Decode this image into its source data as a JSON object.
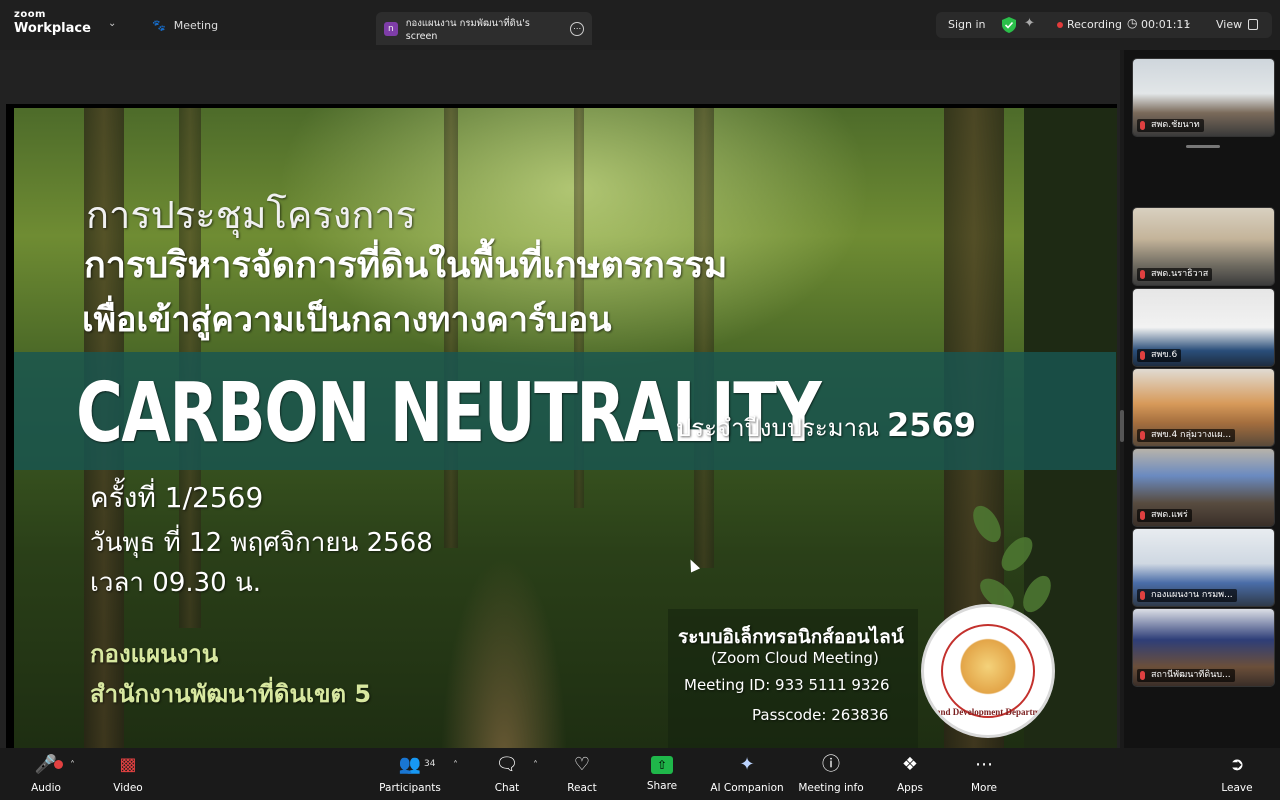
{
  "app": {
    "brand_top": "zoom",
    "brand_bottom": "Workplace",
    "meeting_tab": "Meeting",
    "shared_screen_tab": "กองแผนงาน กรมพัฒนาที่ดิน's screen",
    "shared_avatar": "n"
  },
  "status": {
    "sign_in": "Sign in",
    "recording": "Recording",
    "elapsed": "00:01:11",
    "view": "View"
  },
  "slide": {
    "line1": "การประชุมโครงการ",
    "line2": "การบริหารจัดการที่ดินในพื้นที่เกษตรกรรม",
    "line3": "เพื่อเข้าสู่ความเป็นกลางทางคาร์บอน",
    "headline": "CARBON NEUTRALITY",
    "fiscal_label": "ประจำปีงบประมาณ",
    "fiscal_year": "2569",
    "session": "ครั้งที่ 1/2569",
    "date": "วันพุธ ที่ 12 พฤศจิกายน 2568",
    "time": "เวลา 09.30 น.",
    "org1": "กองแผนงาน",
    "org2": "สำนักงานพัฒนาที่ดินเขต 5",
    "zoom_line1": "ระบบอิเล็กทรอนิกส์ออนไลน์",
    "zoom_line2": "(Zoom Cloud Meeting)",
    "meeting_id": "Meeting ID: 933 5111 9326",
    "passcode": "Passcode: 263836",
    "seal_text": "Land Development Department"
  },
  "participants": [
    {
      "name": "สพด.ชัยนาท"
    },
    {
      "name": "สพด.นราธิวาส"
    },
    {
      "name": "สพข.6"
    },
    {
      "name": "สพข.4 กลุ่มวางแผ..."
    },
    {
      "name": "สพด.แพร่"
    },
    {
      "name": "กองแผนงาน กรมพ..."
    },
    {
      "name": "สถานีพัฒนาที่ดินบ..."
    }
  ],
  "toolbar": {
    "audio": "Audio",
    "video": "Video",
    "participants": "Participants",
    "participants_count": "34",
    "chat": "Chat",
    "react": "React",
    "share": "Share",
    "ai_companion": "AI Companion",
    "meeting_info": "Meeting info",
    "apps": "Apps",
    "more": "More",
    "leave": "Leave"
  },
  "colors": {
    "recording_dot": "#e23b3b",
    "share_green": "#1fb74a",
    "band_teal": "#195550",
    "leave_red": "#e24141"
  }
}
